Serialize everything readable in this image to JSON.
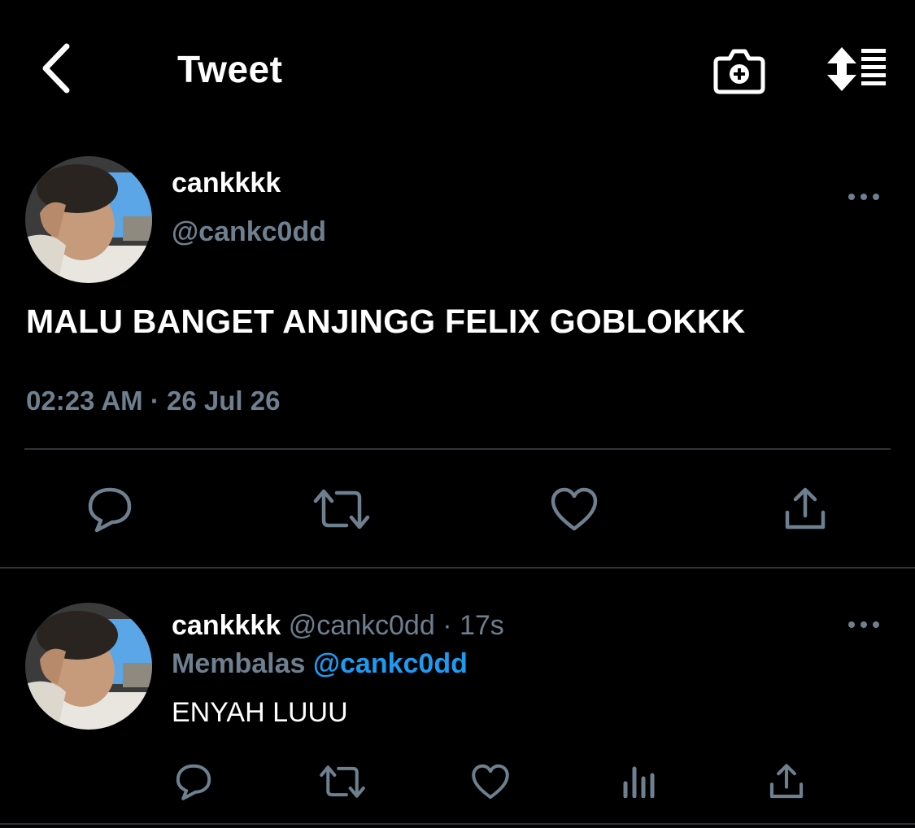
{
  "header": {
    "title": "Tweet"
  },
  "icons": {
    "back": "back-chevron-icon",
    "camera": "camera-add-icon",
    "sort": "sort-list-icon",
    "more": "more-dots-icon",
    "reply": "reply-bubble-icon",
    "retweet": "retweet-icon",
    "like": "heart-icon",
    "share": "share-upload-icon",
    "stats": "stats-bars-icon"
  },
  "colors": {
    "background": "#000000",
    "muted": "#6e7f8f",
    "accent": "#1d9bf0",
    "divider": "#2f3336"
  },
  "tweet": {
    "display_name": "cankkkk",
    "handle": "@cankc0dd",
    "text": "MALU BANGET ANJINGG FELIX GOBLOKKK",
    "time": "02:23 AM · 26 Jul 26"
  },
  "reply": {
    "display_name": "cankkkk",
    "meta": "@cankc0dd · 17s",
    "replying_label": "Membalas",
    "replying_to": "@cankc0dd",
    "text": "ENYAH LUUU"
  }
}
